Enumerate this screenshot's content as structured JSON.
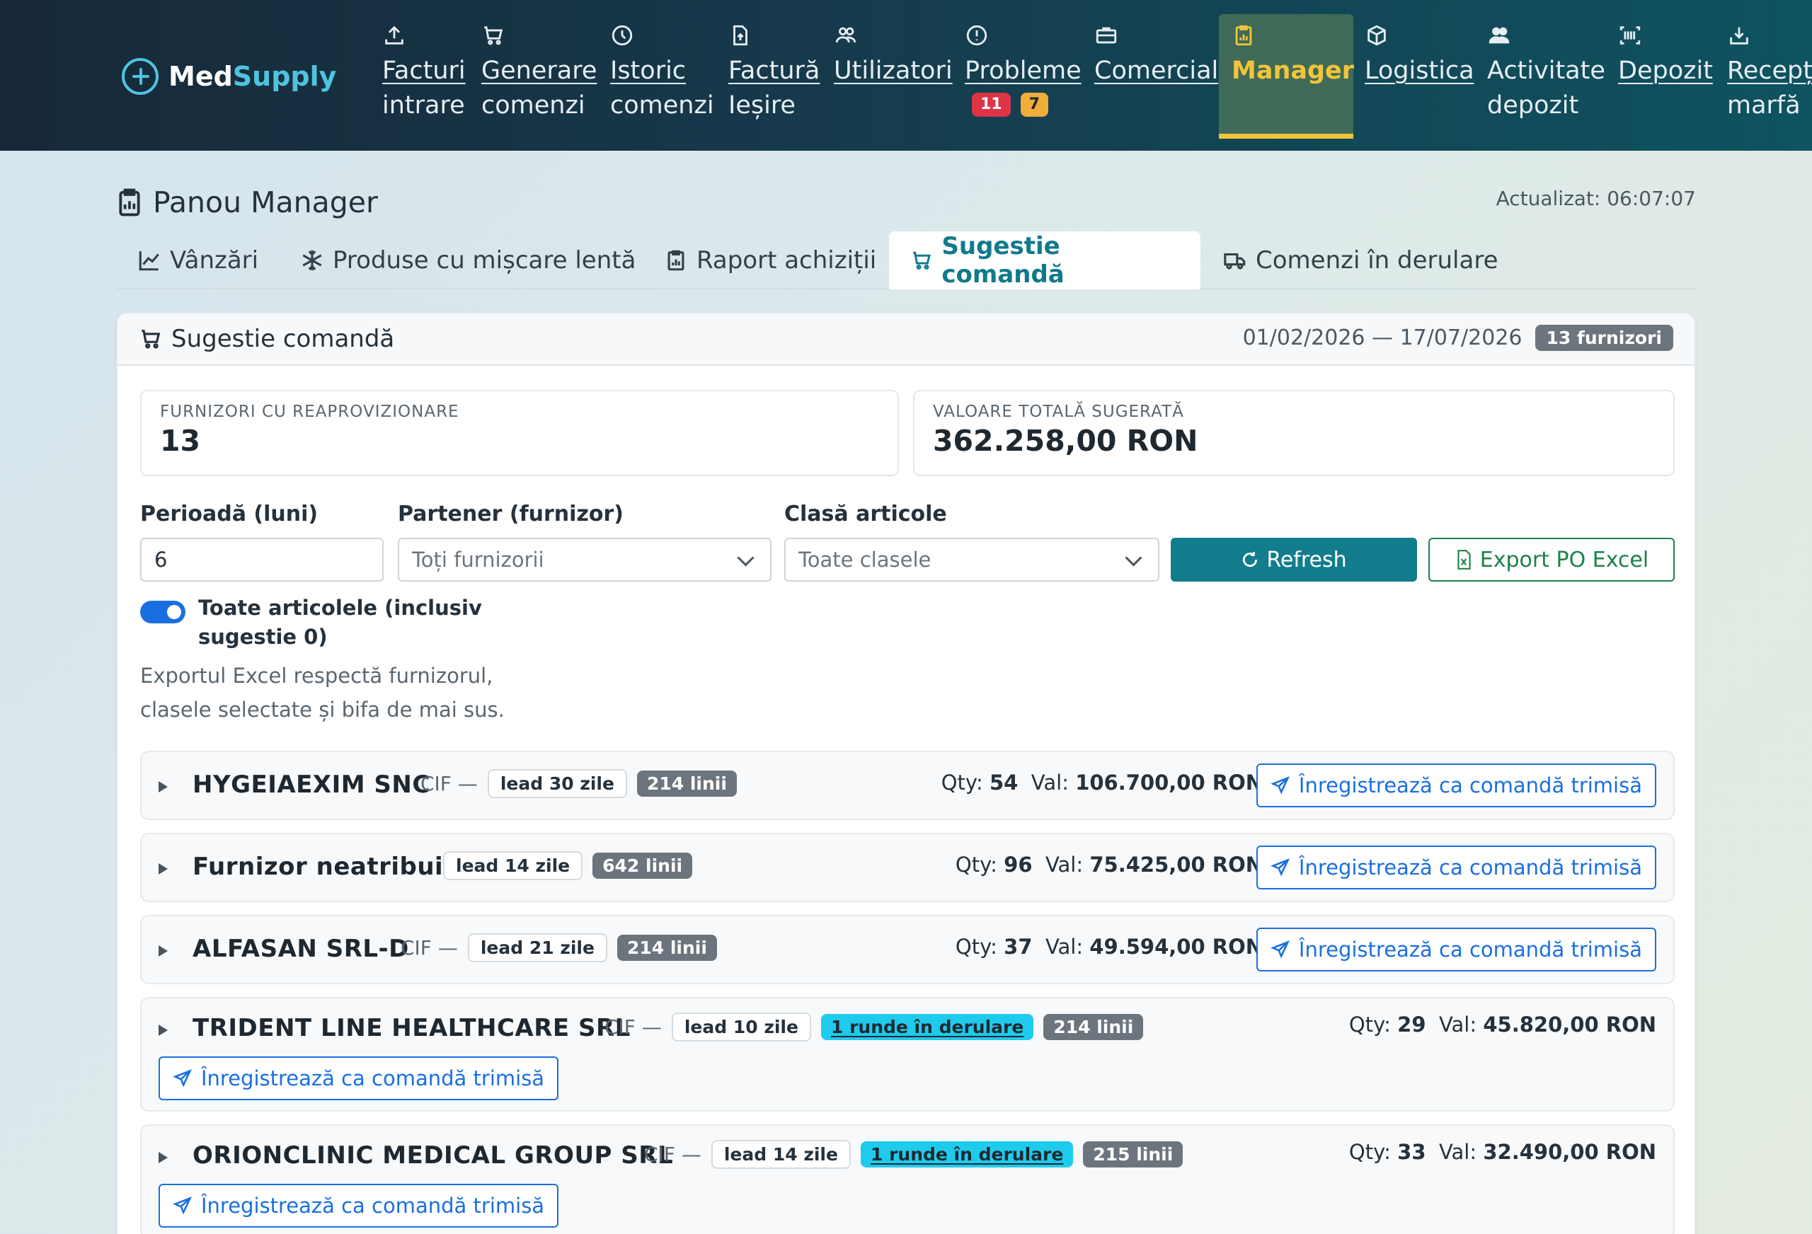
{
  "brand": {
    "name_a": "Med",
    "name_b": "Supply"
  },
  "nav": {
    "facturi_intrare": [
      "Facturi",
      "intrare"
    ],
    "generare_comenzi": [
      "Generare",
      "comenzi"
    ],
    "istoric_comenzi": [
      "Istoric",
      "comenzi"
    ],
    "factura_iesire": [
      "Factură",
      "Ieșire"
    ],
    "utilizatori": "Utilizatori",
    "probleme": "Probleme",
    "probleme_badge_red": "11",
    "probleme_badge_yellow": "7",
    "comercial": "Comercial",
    "manager": "Manager",
    "logistica": "Logistica",
    "activitate_depozit": [
      "Activitate",
      "depozit"
    ],
    "depozit": "Depozit",
    "receptie_marfa": [
      "Recepți",
      "marfă"
    ]
  },
  "page": {
    "title": "Panou Manager",
    "updated": "Actualizat: 06:07:07"
  },
  "tabs": [
    "Vânzări",
    "Produse cu mișcare lentă",
    "Raport achiziții",
    "Sugestie comandă",
    "Comenzi în derulare"
  ],
  "card": {
    "title": "Sugestie comandă",
    "date_range": "01/02/2026 — 17/07/2026",
    "supplier_count_badge": "13 furnizori"
  },
  "stats": {
    "suppliers_label": "Furnizori cu reaprovizionare",
    "suppliers_value": "13",
    "total_label": "Valoare totală sugerată",
    "total_value": "362.258,00 RON"
  },
  "filters": {
    "period_label": "Perioadă (luni)",
    "period_value": "6",
    "partner_label": "Partener (furnizor)",
    "partner_value": "Toți furnizorii",
    "class_label": "Clasă articole",
    "class_value": "Toate clasele",
    "refresh_label": "Refresh",
    "export_label": "Export PO Excel",
    "toggle_label": "Toate articolele (inclusiv sugestie 0)",
    "toggle_on": true,
    "help_text": "Exportul Excel respectă furnizorul, clasele selectate și bifa de mai sus."
  },
  "send_label": "Înregistrează ca comandă trimisă",
  "qty_label": "Qty:",
  "val_label": "Val:",
  "suppliers": [
    {
      "name": "HYGEIAEXIM SNC",
      "cif": "CIF —",
      "lead": "lead 30 zile",
      "rounds": "",
      "lines": "214 linii",
      "qty": "54",
      "val": "106.700,00 RON"
    },
    {
      "name": "Furnizor neatribuit",
      "cif": "",
      "lead": "lead 14 zile",
      "rounds": "",
      "lines": "642 linii",
      "qty": "96",
      "val": "75.425,00 RON"
    },
    {
      "name": "ALFASAN SRL-D",
      "cif": "CIF —",
      "lead": "lead 21 zile",
      "rounds": "",
      "lines": "214 linii",
      "qty": "37",
      "val": "49.594,00 RON"
    },
    {
      "name": "TRIDENT LINE HEALTHCARE SRL",
      "cif": "CIF —",
      "lead": "lead 10 zile",
      "rounds": "1 runde în derulare",
      "lines": "214 linii",
      "qty": "29",
      "val": "45.820,00 RON"
    },
    {
      "name": "ORIONCLINIC MEDICAL GROUP SRL",
      "cif": "CIF —",
      "lead": "lead 14 zile",
      "rounds": "1 runde în derulare",
      "lines": "215 linii",
      "qty": "33",
      "val": "32.490,00 RON"
    }
  ],
  "colors": {
    "accent": "#127d8c",
    "manager_highlight": "#f4c43a",
    "send_blue": "#1a6fe0",
    "export_green": "#1c8248"
  }
}
